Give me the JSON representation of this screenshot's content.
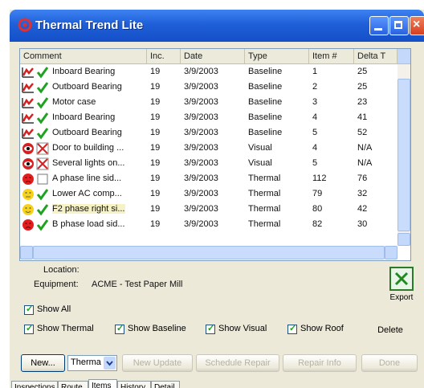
{
  "window": {
    "title": "Thermal Trend Lite"
  },
  "list": {
    "columns": [
      "Comment",
      "Inc.",
      "Date",
      "Type",
      "Item #",
      "Delta T"
    ],
    "rows": [
      {
        "icon1": "chart-icon",
        "icon2": "checkmark-icon",
        "comment": "Inboard Bearing",
        "inc": "19",
        "date": "3/9/2003",
        "type": "Baseline",
        "item": "1",
        "delta": "25"
      },
      {
        "icon1": "chart-icon",
        "icon2": "checkmark-icon",
        "comment": "Outboard Bearing",
        "inc": "19",
        "date": "3/9/2003",
        "type": "Baseline",
        "item": "2",
        "delta": "25"
      },
      {
        "icon1": "chart-icon",
        "icon2": "checkmark-icon",
        "comment": "Motor case",
        "inc": "19",
        "date": "3/9/2003",
        "type": "Baseline",
        "item": "3",
        "delta": "23"
      },
      {
        "icon1": "chart-icon",
        "icon2": "checkmark-icon",
        "comment": "Inboard Bearing",
        "inc": "19",
        "date": "3/9/2003",
        "type": "Baseline",
        "item": "4",
        "delta": "41"
      },
      {
        "icon1": "chart-icon",
        "icon2": "checkmark-icon",
        "comment": "Outboard Bearing",
        "inc": "19",
        "date": "3/9/2003",
        "type": "Baseline",
        "item": "5",
        "delta": "52"
      },
      {
        "icon1": "eye-icon",
        "icon2": "cross-icon",
        "comment": "Door to building ...",
        "inc": "19",
        "date": "3/9/2003",
        "type": "Visual",
        "item": "4",
        "delta": "N/A"
      },
      {
        "icon1": "eye-icon",
        "icon2": "cross-icon",
        "comment": "Several lights on...",
        "inc": "19",
        "date": "3/9/2003",
        "type": "Visual",
        "item": "5",
        "delta": "N/A"
      },
      {
        "icon1": "frown-face-icon",
        "icon2": "empty-box-icon",
        "comment": "A phase line sid...",
        "inc": "19",
        "date": "3/9/2003",
        "type": "Thermal",
        "item": "112",
        "delta": "76"
      },
      {
        "icon1": "neutral-face-icon",
        "icon2": "checkmark-icon",
        "comment": "Lower AC comp...",
        "inc": "19",
        "date": "3/9/2003",
        "type": "Thermal",
        "item": "79",
        "delta": "32"
      },
      {
        "icon1": "smile-face-icon",
        "icon2": "checkmark-icon",
        "comment": "F2 phase right si...",
        "inc": "19",
        "date": "3/9/2003",
        "type": "Thermal",
        "item": "80",
        "delta": "42",
        "selected": true
      },
      {
        "icon1": "frown-face-icon",
        "icon2": "checkmark-icon",
        "comment": "B phase load sid...",
        "inc": "19",
        "date": "3/9/2003",
        "type": "Thermal",
        "item": "82",
        "delta": "30"
      }
    ]
  },
  "info": {
    "location_label": "Location:",
    "equipment_label": "Equipment:",
    "equipment_value": "ACME - Test Paper Mill"
  },
  "export": {
    "label": "Export"
  },
  "filters": {
    "show_all": "Show All",
    "show_thermal": "Show Thermal",
    "show_baseline": "Show Baseline",
    "show_visual": "Show Visual",
    "show_roof": "Show Roof"
  },
  "buttons": {
    "delete": "Delete",
    "new": "New...",
    "new_update": "New Update",
    "schedule_repair": "Schedule Repair",
    "repair_info": "Repair Info",
    "done": "Done"
  },
  "type_select": {
    "value": "Therma"
  },
  "tabs": [
    "Inspections",
    "Route",
    "Items",
    "History",
    "Detail"
  ],
  "active_tab": "Items",
  "colors": {
    "title_bar": "#1f5fd8",
    "window_bg": "#ece9d8",
    "check_green": "#21a121",
    "cross_red": "#d42020"
  }
}
